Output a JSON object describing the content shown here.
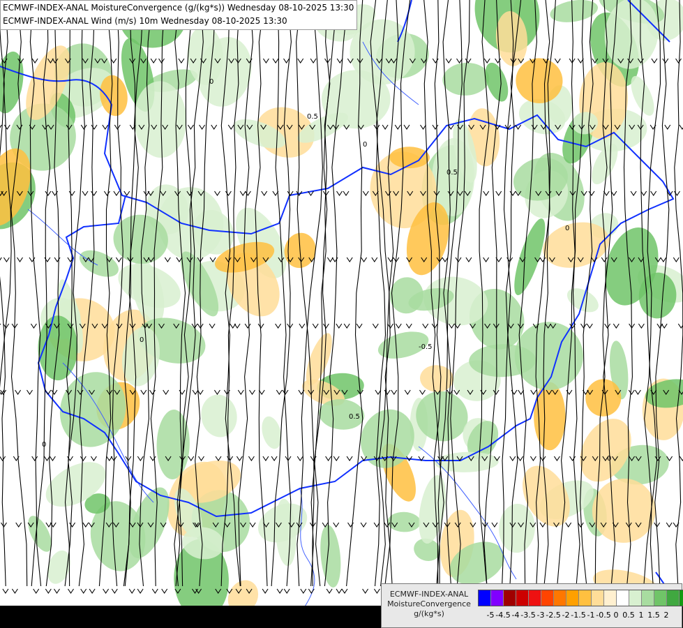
{
  "header": {
    "line1": "ECMWF-INDEX-ANAL MoistureConvergence (g/(kg*s)) Wednesday 08-10-2025 13:30",
    "line2": "ECMWF-INDEX-ANAL Wind (m/s) 10m Wednesday 08-10-2025 13:30"
  },
  "legend": {
    "title_line1": "ECMWF-INDEX-ANAL",
    "title_line2": "MoistureConvergence",
    "title_line3": "g/(kg*s)",
    "colors": [
      "#0000ff",
      "#8000ff",
      "#a00000",
      "#cc0000",
      "#ee1111",
      "#ff4400",
      "#ff7700",
      "#ffa000",
      "#ffc040",
      "#ffdd99",
      "#fff0d0",
      "#ffffff",
      "#d8f0d0",
      "#a8dca0",
      "#70c468",
      "#40a840",
      "#139a13"
    ],
    "ticks": [
      "-5",
      "-4.5",
      "-4",
      "-3.5",
      "-3",
      "-2.5",
      "-2",
      "-1.5",
      "-1",
      "-0.5",
      "0",
      "0.5",
      "1",
      "1.5",
      "2"
    ]
  },
  "map": {
    "colors": {
      "border": "#1030ff",
      "river": "#4060ff",
      "streamline": "#000000",
      "bottom_strip": "#000000",
      "green_light": "#d8f0d0",
      "green_mid": "#a8dca0",
      "green_dark": "#70c468",
      "orange_light": "#ffdd99",
      "orange_mid": "#ffc040"
    },
    "contour_labels": [
      "0.5",
      "0",
      "0",
      "0.5",
      "0",
      "0",
      "0.5",
      "0",
      "-0.5",
      "0"
    ]
  }
}
